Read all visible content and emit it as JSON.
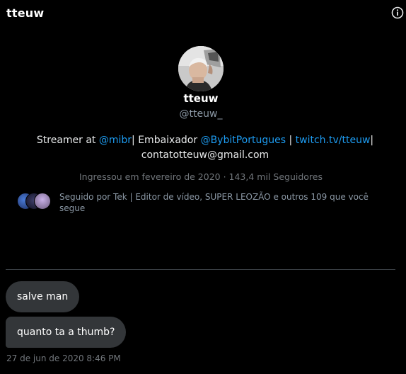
{
  "header": {
    "title": "tteuw",
    "info_icon": "info-icon"
  },
  "profile": {
    "display_name": "tteuw",
    "handle": "@tteuw_",
    "bio": {
      "part1": "Streamer at ",
      "link_mibr": "@mibr",
      "part2": "| Embaixador ",
      "link_bybit": "@BybitPortugues",
      "part3": " | ",
      "link_twitch": "twitch.tv/tteuw",
      "part4": "|",
      "email": "contatotteuw@gmail.com"
    },
    "joined": "Ingressou em fevereiro de 2020 · 143,4 mil Seguidores",
    "followed_by": "Seguido por Tek | Editor de vídeo, SUPER LEOZÃO e outros 109 que você segue"
  },
  "messages": [
    {
      "text": "salve man"
    },
    {
      "text": "quanto ta a thumb?"
    }
  ],
  "timestamp": "27 de jun de 2020 8:46 PM",
  "colors": {
    "background": "#000000",
    "bubble": "#333639",
    "link": "#1d9bf0",
    "muted": "#71767b"
  }
}
